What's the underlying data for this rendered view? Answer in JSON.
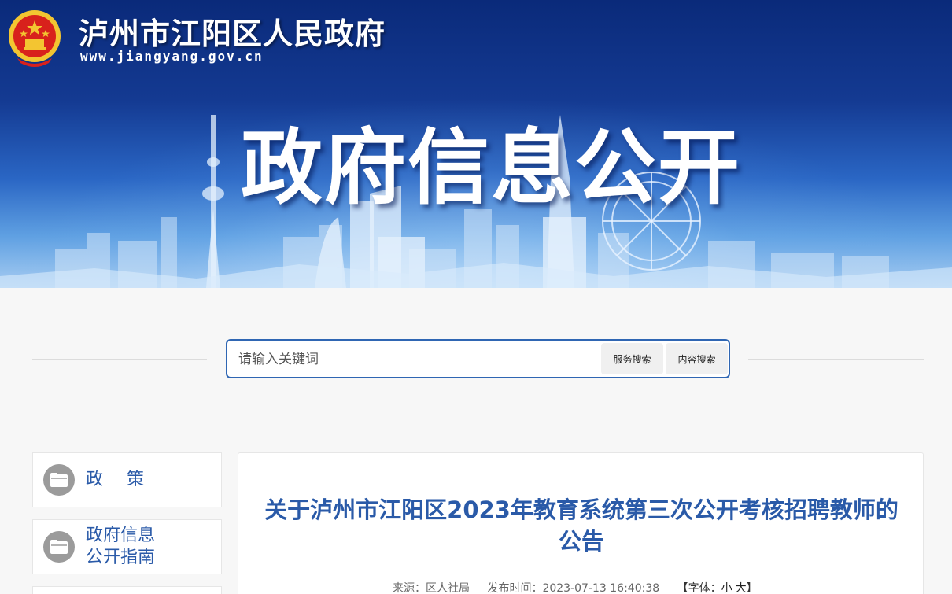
{
  "header": {
    "site_title": "泸州市江阳区人民政府",
    "site_url": "www.jiangyang.gov.cn",
    "hero_title": "政府信息公开"
  },
  "search": {
    "placeholder": "请输入关键词",
    "service_button": "服务搜索",
    "content_button": "内容搜索"
  },
  "sidebar": {
    "items": [
      {
        "label": "政策",
        "icon": "folder-icon"
      },
      {
        "label_line1": "政府信息",
        "label_line2": "公开指南",
        "icon": "folder-icon"
      }
    ]
  },
  "article": {
    "title": "关于泸州市江阳区2023年教育系统第三次公开考核招聘教师的公告",
    "source_label": "来源：",
    "source": "区人社局",
    "publish_label": "发布时间：",
    "publish_time": "2023-07-13 16:40:38",
    "font_label_open": "【字体：",
    "font_small": "小",
    "font_large": "大",
    "font_label_close": "】"
  },
  "colors": {
    "brand_blue": "#2a5aa8",
    "search_border": "#2f66b3",
    "banner_top": "#0a2a7a"
  }
}
